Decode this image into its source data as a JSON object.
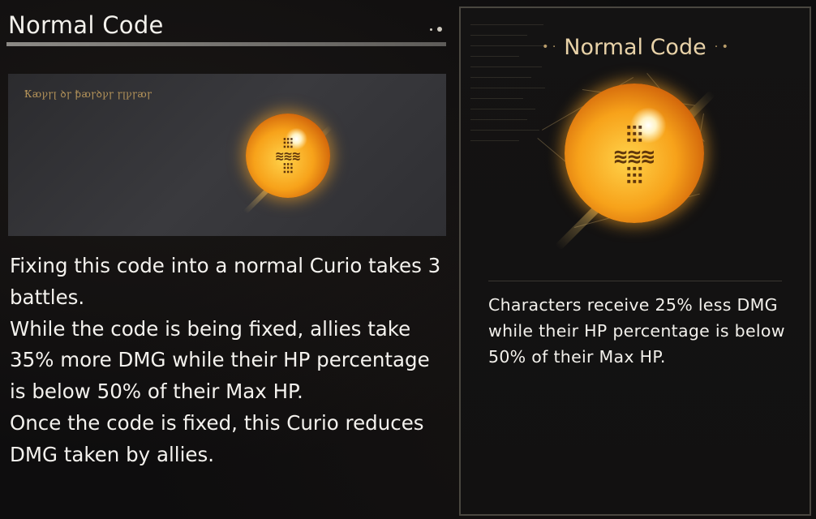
{
  "left_panel": {
    "title": "Normal Code",
    "preview_cipher_text": "Ꝁꜵꝩꞅꞁ ꝺꞅ ꝥꜵꞅꝺꝩꞅ ꞅꞁꝩꞅꜵꞅ",
    "orb_glyphs": [
      "⫶⫶⫶",
      "≋≋≋",
      "⫶⫶⫶"
    ],
    "description": [
      "Fixing this code into a normal Curio takes 3 battles.",
      "While the code is being fixed, allies take 35% more DMG while their HP percentage is below 50% of their Max HP.",
      "Once the code is fixed, this Curio reduces DMG taken by allies."
    ]
  },
  "right_card": {
    "title": "Normal Code",
    "title_deco_left": "• ·",
    "title_deco_right": "· •",
    "orb_glyphs": [
      "⫶⫶⫶",
      "≋≋≋",
      "⫶⫶⫶"
    ],
    "description": "Characters receive 25% less DMG while their HP percentage is below 50% of their Max HP."
  },
  "colors": {
    "orb_core": "#f7a21a",
    "accent_gold": "#e8d2a8",
    "text_white": "#f4f2ee",
    "card_border": "#4a4740"
  },
  "icons": {
    "orb": "curio-orb-icon",
    "title_dots": "title-dots-icon"
  }
}
